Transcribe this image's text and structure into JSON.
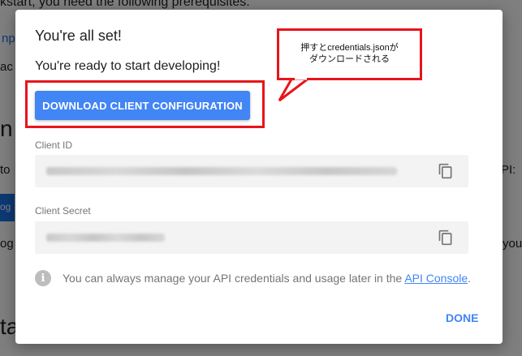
{
  "background": {
    "line1": "kstart, you need the following prerequisites:",
    "frag_np": "np",
    "frag_ac": "ac",
    "frag_n": "n",
    "frag_to": "to",
    "frag_og_btn": "og",
    "frag_og": "og",
    "frag_ta": "ta",
    "frag_pi": "PI:",
    "frag_you": "you"
  },
  "modal": {
    "title": "You're all set!",
    "subtitle": "You're ready to start developing!",
    "download_button": "DOWNLOAD CLIENT CONFIGURATION",
    "client_id_label": "Client ID",
    "client_secret_label": "Client Secret",
    "info_text": "You can always manage your API credentials and usage later in the ",
    "info_link": "API Console",
    "info_suffix": ".",
    "done_button": "DONE"
  },
  "annotation": {
    "line1": "押すとcredentials.jsonが",
    "line2": "ダウンロードされる"
  },
  "colors": {
    "accent": "#4285f4",
    "annotation_red": "#e8141b"
  },
  "icons": {
    "copy": "copy-icon",
    "info": "info-icon"
  }
}
